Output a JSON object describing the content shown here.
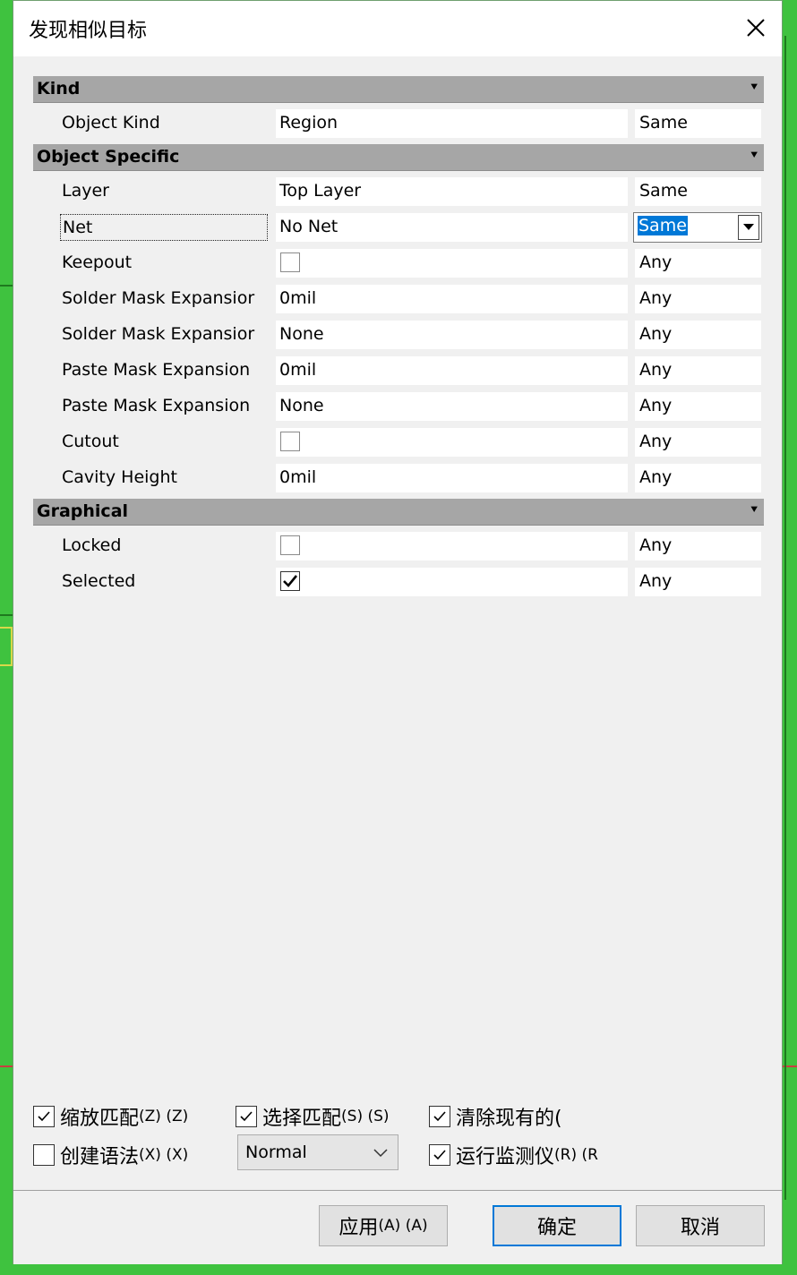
{
  "window": {
    "title": "发现相似目标"
  },
  "sections": {
    "kind": {
      "label": "Kind"
    },
    "object_specific": {
      "label": "Object Specific"
    },
    "graphical": {
      "label": "Graphical"
    }
  },
  "rows": {
    "object_kind": {
      "name": "Object Kind",
      "value": "Region",
      "match": "Same"
    },
    "layer": {
      "name": "Layer",
      "value": "Top Layer",
      "match": "Same"
    },
    "net": {
      "name": "Net",
      "value": "No Net",
      "match": "Same"
    },
    "keepout": {
      "name": "Keepout",
      "checked": false,
      "match": "Any"
    },
    "solder_mask_expansion_1": {
      "name": "Solder Mask Expansior",
      "value": "0mil",
      "match": "Any"
    },
    "solder_mask_expansion_2": {
      "name": "Solder Mask Expansior",
      "value": "None",
      "match": "Any"
    },
    "paste_mask_expansion_1": {
      "name": "Paste Mask Expansion",
      "value": "0mil",
      "match": "Any"
    },
    "paste_mask_expansion_2": {
      "name": "Paste Mask Expansion",
      "value": "None",
      "match": "Any"
    },
    "cutout": {
      "name": "Cutout",
      "checked": false,
      "match": "Any"
    },
    "cavity_height": {
      "name": "Cavity Height",
      "value": "0mil",
      "match": "Any"
    },
    "locked": {
      "name": "Locked",
      "checked": false,
      "match": "Any"
    },
    "selected": {
      "name": "Selected",
      "checked": true,
      "match": "Any"
    }
  },
  "options": {
    "zoom_matching": {
      "label": "缩放匹配",
      "accel": "(Z) (Z)",
      "checked": true
    },
    "select_matching": {
      "label": "选择匹配",
      "accel": "(S) (S)",
      "checked": true
    },
    "clear_existing": {
      "label": "清除现有的(",
      "checked": true
    },
    "create_expression": {
      "label": "创建语法",
      "accel": "(X) (X)",
      "checked": false
    },
    "mode_combo": {
      "value": "Normal"
    },
    "run_inspector": {
      "label": "运行监测仪",
      "accel": "(R) (R",
      "checked": true
    }
  },
  "buttons": {
    "apply": {
      "label": "应用",
      "accel": "(A) (A)"
    },
    "ok": {
      "label": "确定"
    },
    "cancel": {
      "label": "取消"
    }
  }
}
